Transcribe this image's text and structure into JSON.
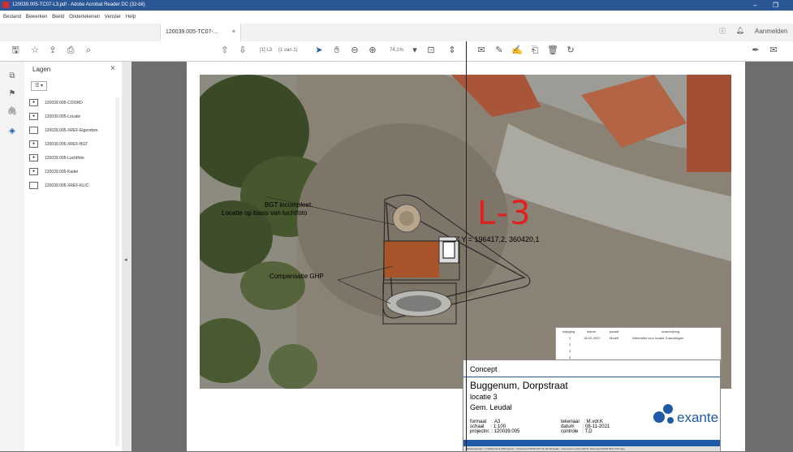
{
  "window": {
    "title": "120039.005-TC07-L3.pdf - Adobe Acrobat Reader DC (32-bit)"
  },
  "menu": [
    "Bestand",
    "Bewerken",
    "Beeld",
    "Ondertekenen",
    "Venster",
    "Help"
  ],
  "tabs": {
    "doc": "120039.005-TC07-...",
    "close": "×",
    "signin": "Aanmelden"
  },
  "toolbar": {
    "page_input": "[1] L3",
    "page_of": "(1 van 1)",
    "zoom": "74,1%"
  },
  "layers_panel": {
    "title": "Lagen",
    "close": "×",
    "options": "☰ ▾",
    "items": [
      {
        "label": "120039.005-COORD",
        "visible": true
      },
      {
        "label": "120039.005-Locatie",
        "visible": true
      },
      {
        "label": "120039.005-XREF-Eigendom",
        "visible": false
      },
      {
        "label": "120039.005-XREF-BGT",
        "visible": true
      },
      {
        "label": "120039.005-Luchtfoto",
        "visible": true
      },
      {
        "label": "120039.005-Kader",
        "visible": true
      },
      {
        "label": "120039.005-XREF-KLIC",
        "visible": false
      }
    ]
  },
  "drawing": {
    "bgt_label_1": "BGT incompleet.",
    "bgt_label_2": "Locatie op basis van luchtfoto",
    "location_code": "L-3",
    "coords": "X Y = 196417,2, 360420,1",
    "compensatie": "Compensatie GHP"
  },
  "revision_table": {
    "headers": [
      "wijziging",
      "datum",
      "paraaf",
      "omschrijving"
    ],
    "rows": [
      [
        "1",
        "18-02-2022",
        "MvdrK",
        "Alternatief voor locatie 3 aandragen"
      ],
      [
        "2",
        "",
        "",
        ""
      ],
      [
        "3",
        "",
        "",
        ""
      ],
      [
        "4",
        "",
        "",
        ""
      ]
    ]
  },
  "titleblock": {
    "status": "Concept",
    "project": "Buggenum, Dorpstraat",
    "location": "locatie 3",
    "municipality": "Gem. Leudal",
    "meta_left": "formaat    : A3\nschaal     : 1:100\nprojectnr. : 120039.005",
    "meta_right": "tekenaar   : M.vdr.K\ndatum      : 08-11-2021\ncontrole   : T.D",
    "logo": "exante",
    "footer": "Bestandsnaam: C:\\All\\Exante\\1-W\\Projecten - Projecten\\120039.005 Sis Wind\\Uitgaat - Gemeente Leudal 100.01 Tekening\\120039.005-TC07.dwg"
  },
  "colors": {
    "titlebar": "#2b5797",
    "accent": "#e02020",
    "brand": "#1e5aa8"
  }
}
